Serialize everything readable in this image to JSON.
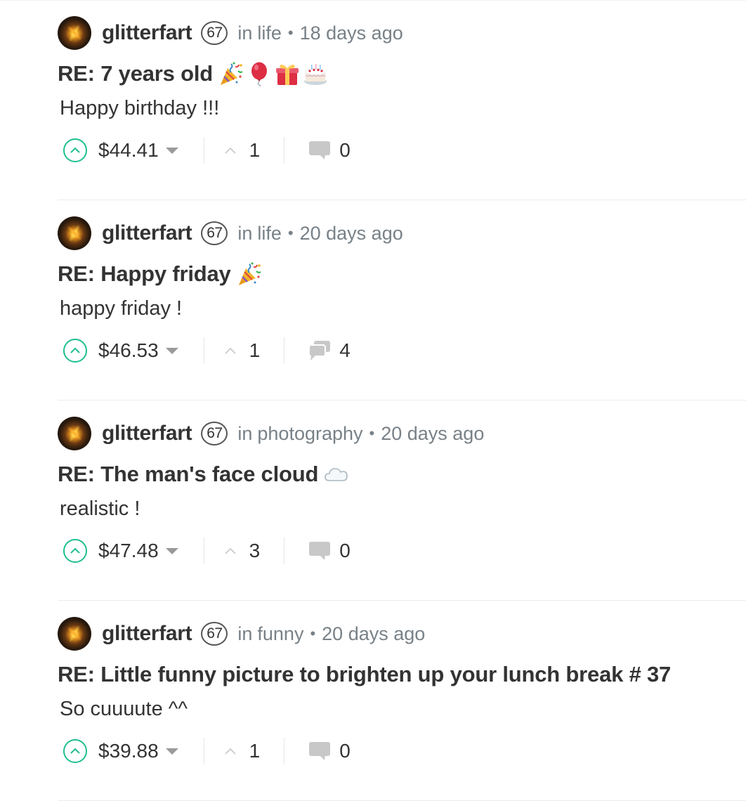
{
  "colors": {
    "upvote_accent": "#1fbf8f",
    "meta_text": "#788187",
    "primary_text": "#333333",
    "icon_gray": "#c8c8c8"
  },
  "posts": [
    {
      "author": "glitterfart",
      "reputation": "67",
      "in_label": "in",
      "category": "life",
      "separator": "•",
      "time": "18 days ago",
      "title": "RE: 7 years old",
      "title_emojis": [
        "party-popper-emoji",
        "balloon-emoji",
        "gift-emoji",
        "birthday-cake-emoji"
      ],
      "body": "Happy birthday !!!",
      "payout": "$44.41",
      "votes": "1",
      "replies": "0",
      "reply_icon": "comment-icon"
    },
    {
      "author": "glitterfart",
      "reputation": "67",
      "in_label": "in",
      "category": "life",
      "separator": "•",
      "time": "20 days ago",
      "title": "RE: Happy friday",
      "title_emojis": [
        "party-popper-emoji"
      ],
      "body": "happy friday !",
      "payout": "$46.53",
      "votes": "1",
      "replies": "4",
      "reply_icon": "comments-icon"
    },
    {
      "author": "glitterfart",
      "reputation": "67",
      "in_label": "in",
      "category": "photography",
      "separator": "•",
      "time": "20 days ago",
      "title": "RE: The man's face cloud",
      "title_emojis": [
        "cloud-emoji"
      ],
      "body": "realistic !",
      "payout": "$47.48",
      "votes": "3",
      "replies": "0",
      "reply_icon": "comment-icon"
    },
    {
      "author": "glitterfart",
      "reputation": "67",
      "in_label": "in",
      "category": "funny",
      "separator": "•",
      "time": "20 days ago",
      "title": "RE: Little funny picture to brighten up your lunch break # 37",
      "title_emojis": [],
      "body": "So cuuuute ^^",
      "payout": "$39.88",
      "votes": "1",
      "replies": "0",
      "reply_icon": "comment-icon"
    }
  ]
}
